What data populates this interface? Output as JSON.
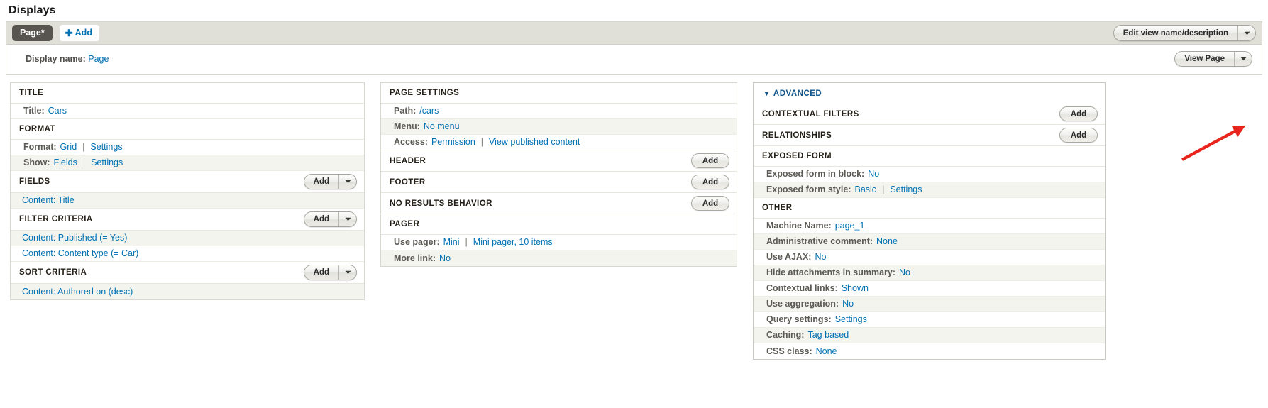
{
  "page": {
    "heading": "Displays"
  },
  "tabs": {
    "display_tab": "Page*",
    "add_display": "Add",
    "add_icon": "plus-icon",
    "edit_view_name": "Edit view name/description",
    "dropdown_icon": "chevron-down-icon"
  },
  "display_bar": {
    "label": "Display name:",
    "value": "Page",
    "view_page": "View Page",
    "dropdown_icon": "chevron-down-icon"
  },
  "left_column": {
    "title_bucket": {
      "header": "Title",
      "rows": [
        {
          "label": "Title:",
          "links": [
            "Cars"
          ]
        }
      ]
    },
    "format_bucket": {
      "header": "Format",
      "rows": [
        {
          "label": "Format:",
          "links": [
            "Grid",
            "Settings"
          ]
        },
        {
          "label": "Show:",
          "links": [
            "Fields",
            "Settings"
          ]
        }
      ]
    },
    "fields_bucket": {
      "header": "Fields",
      "add": "Add",
      "rows": [
        {
          "link": "Content: Title"
        }
      ]
    },
    "filter_bucket": {
      "header": "Filter criteria",
      "add": "Add",
      "rows": [
        {
          "link": "Content: Published (= Yes)"
        },
        {
          "link": "Content: Content type (= Car)"
        }
      ]
    },
    "sort_bucket": {
      "header": "Sort criteria",
      "add": "Add",
      "rows": [
        {
          "link": "Content: Authored on (desc)"
        }
      ]
    }
  },
  "middle_column": {
    "page_settings": {
      "header": "Page settings",
      "rows": [
        {
          "label": "Path:",
          "links": [
            "/cars"
          ]
        },
        {
          "label": "Menu:",
          "links": [
            "No menu"
          ]
        },
        {
          "label": "Access:",
          "links": [
            "Permission",
            "View published content"
          ]
        }
      ]
    },
    "header_bucket": {
      "header": "Header",
      "add": "Add"
    },
    "footer_bucket": {
      "header": "Footer",
      "add": "Add"
    },
    "no_results_bucket": {
      "header": "No results behavior",
      "add": "Add"
    },
    "pager_bucket": {
      "header": "Pager",
      "rows": [
        {
          "label": "Use pager:",
          "links": [
            "Mini",
            "Mini pager, 10 items"
          ]
        },
        {
          "label": "More link:",
          "links": [
            "No"
          ]
        }
      ]
    }
  },
  "right_column": {
    "advanced": {
      "header": "Advanced",
      "toggle_icon": "triangle-down-icon"
    },
    "contextual_filters": {
      "header": "Contextual filters",
      "add": "Add"
    },
    "relationships": {
      "header": "Relationships",
      "add": "Add"
    },
    "exposed_form": {
      "header": "Exposed form",
      "rows": [
        {
          "label": "Exposed form in block:",
          "links": [
            "No"
          ]
        },
        {
          "label": "Exposed form style:",
          "links": [
            "Basic",
            "Settings"
          ]
        }
      ]
    },
    "other": {
      "header": "Other",
      "rows": [
        {
          "label": "Machine Name:",
          "links": [
            "page_1"
          ]
        },
        {
          "label": "Administrative comment:",
          "links": [
            "None"
          ]
        },
        {
          "label": "Use AJAX:",
          "links": [
            "No"
          ]
        },
        {
          "label": "Hide attachments in summary:",
          "links": [
            "No"
          ]
        },
        {
          "label": "Contextual links:",
          "links": [
            "Shown"
          ]
        },
        {
          "label": "Use aggregation:",
          "links": [
            "No"
          ]
        },
        {
          "label": "Query settings:",
          "links": [
            "Settings"
          ]
        },
        {
          "label": "Caching:",
          "links": [
            "Tag based"
          ]
        },
        {
          "label": "CSS class:",
          "links": [
            "None"
          ]
        }
      ]
    }
  },
  "annotation": {
    "type": "arrow",
    "color": "#e8251c",
    "points_to": "contextual-filters-add-button"
  }
}
